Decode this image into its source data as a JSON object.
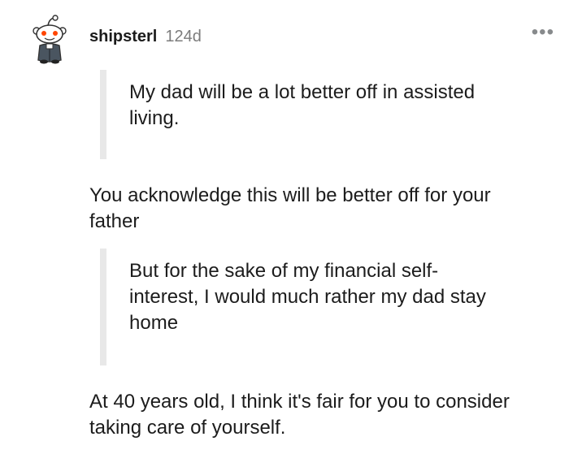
{
  "comment": {
    "username": "shipsterl",
    "age": "124d",
    "more_label": "•••",
    "quote_1": "My dad will be a lot better off in assisted living.",
    "paragraph_1": "You acknowledge this will be better off for your father",
    "quote_2": "But for the sake of my financial self-interest, I would much rather my dad stay home",
    "paragraph_2": "At 40 years old, I think it's fair for you to consider taking care of yourself."
  },
  "icons": {
    "avatar": "snoo-avatar-icon",
    "more": "more-options-icon"
  },
  "colors": {
    "text": "#1c1c1c",
    "meta": "#7c7c7c",
    "quote_bar": "#e8e8e8",
    "snoo_eye": "#ff4500"
  }
}
